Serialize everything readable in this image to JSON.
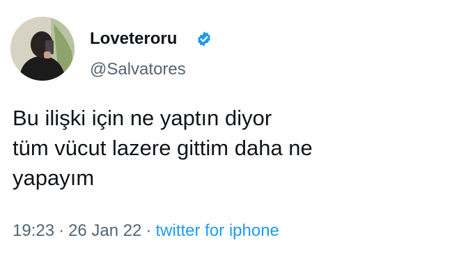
{
  "user": {
    "display_name": "Loveteroru",
    "handle": "@Salvatores",
    "verified": true,
    "verified_color": "#1d9bf0"
  },
  "tweet": {
    "lines": [
      "Bu ilişki için ne yaptın diyor",
      "tüm vücut lazere gittim daha ne",
      "yapayım"
    ]
  },
  "meta": {
    "time": "19:23",
    "separator": "·",
    "date": "26 Jan 22",
    "source": "twitter for iphone",
    "source_color": "#1d9bf0"
  }
}
